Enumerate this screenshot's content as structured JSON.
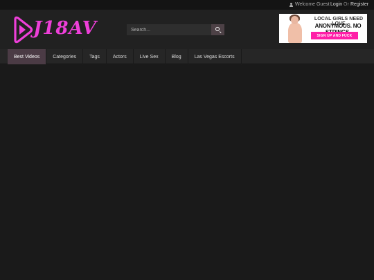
{
  "topbar": {
    "welcome": "Welcome Guest",
    "login": "Login",
    "or": "Or",
    "register": "Register",
    "user_icon": "user-icon"
  },
  "header": {
    "logo_text": "J18AV",
    "logo_color": "#ee3fd9",
    "search": {
      "placeholder": "Search...",
      "value": "",
      "button_icon": "search-icon"
    }
  },
  "ad": {
    "line1": "LOCAL GIRLS NEED LOVE",
    "line2": "ANONYMOUS. NO STRINGS.",
    "cta": "SIGN UP AND FUCK",
    "cta_color": "#ff1fa8"
  },
  "nav": {
    "items": [
      {
        "label": "Best Videos",
        "active": true
      },
      {
        "label": "Categories",
        "active": false
      },
      {
        "label": "Tags",
        "active": false
      },
      {
        "label": "Actors",
        "active": false
      },
      {
        "label": "Live Sex",
        "active": false
      },
      {
        "label": "Blog",
        "active": false
      },
      {
        "label": "Las Vegas Escorts",
        "active": false
      }
    ],
    "active_color": "#4b3b45"
  },
  "colors": {
    "background": "#1c1c1c",
    "header": "#212121",
    "topbar": "#141414"
  }
}
